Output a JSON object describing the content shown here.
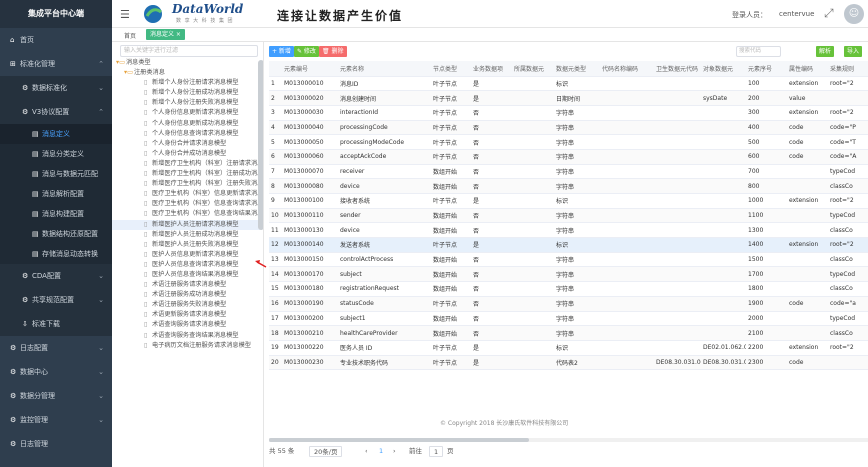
{
  "sidebar": {
    "title": "集成平台中心端",
    "items": [
      {
        "label": "首页",
        "icon": "home-icon"
      },
      {
        "label": "标准化管理",
        "icon": "standard-icon"
      }
    ],
    "sub": [
      {
        "label": "数据标准化"
      },
      {
        "label": "V3协议配置"
      }
    ],
    "sub2": [
      {
        "label": "消息定义"
      },
      {
        "label": "消息分类定义"
      },
      {
        "label": "消息与数据元匹配"
      },
      {
        "label": "消息解析配置"
      },
      {
        "label": "消息构建配置"
      },
      {
        "label": "数据结构还原配置"
      },
      {
        "label": "存储消息动态转换"
      }
    ],
    "sub3": [
      {
        "label": "CDA配置"
      },
      {
        "label": "共享规范配置"
      },
      {
        "label": "标准下载"
      }
    ],
    "bottom": [
      {
        "label": "日志配置"
      },
      {
        "label": "数据中心"
      },
      {
        "label": "数据分管理"
      },
      {
        "label": "监控管理"
      },
      {
        "label": "日志管理"
      }
    ]
  },
  "header": {
    "brand": "DataWorld",
    "brand_sub": "数 享 大 科 技 集 团",
    "slogan": "连接让数据产生价值",
    "login_label": "登录人员：",
    "user": "centervue"
  },
  "tabs": {
    "home": "首页",
    "active": "消息定义 ×"
  },
  "tree": {
    "search_placeholder": "输入关键字进行过滤",
    "root": "消息类型",
    "group": "注册类消息",
    "nodes": [
      "新增个人身份注册请求消息模型",
      "新增个人身份注册成功消息模型",
      "新增个人身份注册失败消息模型",
      "个人身份信息更新请求消息模型",
      "个人身份信息更新成功消息模型",
      "个人身份信息查询请求消息模型",
      "个人身份合并请求消息模型",
      "个人身份合并成功消息模型",
      "新增医疗卫生机构（科室）注册请求消息",
      "新增医疗卫生机构（科室）注册成功消息",
      "新增医疗卫生机构（科室）注册失败消息",
      "医疗卫生机构（科室）信息更新请求消息",
      "医疗卫生机构（科室）信息查询请求消息",
      "医疗卫生机构（科室）信息查询结果消息",
      "新增医护人员注册请求消息模型",
      "新增医护人员注册成功消息模型",
      "新增医护人员注册失败消息模型",
      "医护人员信息更新请求消息模型",
      "医护人员信息查询请求消息模型",
      "医护人员信息查询结果消息模型",
      "术语注册服务请求消息模型",
      "术语注册服务成功消息模型",
      "术语注册服务失败消息模型",
      "术语更新服务请求消息模型",
      "术语查询服务请求消息模型",
      "术语查询服务查询结果消息模型",
      "电子病历文档注册服务请求消息模型"
    ],
    "selected_index": 14
  },
  "toolbar": {
    "add": "+ 新增",
    "edit": "✎ 修改",
    "del": "🗑 删除",
    "search_placeholder": "搜索代码",
    "parse": "解析",
    "batch": "导入"
  },
  "table": {
    "columns": [
      "",
      "元素编号",
      "元素名称",
      "节点类型",
      "业务数据项",
      "所属数据元",
      "数据元类型",
      "代码名称编码",
      "卫生数据元代码",
      "对象数据元",
      "元素序号",
      "属性编码",
      "采集规则"
    ],
    "rows": [
      [
        "1",
        "M013000010",
        "消息ID",
        "叶子节点",
        "是",
        "",
        "标识",
        "",
        "",
        "",
        "100",
        "extension",
        "root=\"2"
      ],
      [
        "2",
        "M013000020",
        "消息创建时间",
        "叶子节点",
        "是",
        "",
        "日期时间",
        "",
        "",
        "sysDate",
        "200",
        "value",
        ""
      ],
      [
        "3",
        "M013000030",
        "interactionId",
        "叶子节点",
        "否",
        "",
        "字符串",
        "",
        "",
        "",
        "300",
        "extension",
        "root=\"2"
      ],
      [
        "4",
        "M013000040",
        "processingCode",
        "叶子节点",
        "否",
        "",
        "字符串",
        "",
        "",
        "",
        "400",
        "code",
        "code=\"P"
      ],
      [
        "5",
        "M013000050",
        "processingModeCode",
        "叶子节点",
        "否",
        "",
        "字符串",
        "",
        "",
        "",
        "500",
        "code",
        "code=\"T"
      ],
      [
        "6",
        "M013000060",
        "acceptAckCode",
        "叶子节点",
        "否",
        "",
        "字符串",
        "",
        "",
        "",
        "600",
        "code",
        "code=\"A"
      ],
      [
        "7",
        "M013000070",
        "receiver",
        "数组开始",
        "否",
        "",
        "字符串",
        "",
        "",
        "",
        "700",
        "",
        "typeCod"
      ],
      [
        "8",
        "M013000080",
        "device",
        "数组开始",
        "否",
        "",
        "字符串",
        "",
        "",
        "",
        "800",
        "",
        "classCo"
      ],
      [
        "9",
        "M013000100",
        "接收者系统",
        "叶子节点",
        "是",
        "",
        "标识",
        "",
        "",
        "",
        "1000",
        "extension",
        "root=\"2"
      ],
      [
        "10",
        "M013000110",
        "sender",
        "数组开始",
        "否",
        "",
        "字符串",
        "",
        "",
        "",
        "1100",
        "",
        "typeCod"
      ],
      [
        "11",
        "M013000130",
        "device",
        "数组开始",
        "否",
        "",
        "字符串",
        "",
        "",
        "",
        "1300",
        "",
        "classCo"
      ],
      [
        "12",
        "M013000140",
        "发送者系统",
        "叶子节点",
        "是",
        "",
        "标识",
        "",
        "",
        "",
        "1400",
        "extension",
        "root=\"2"
      ],
      [
        "13",
        "M013000150",
        "controlActProcess",
        "数组开始",
        "否",
        "",
        "字符串",
        "",
        "",
        "",
        "1500",
        "",
        "classCo"
      ],
      [
        "14",
        "M013000170",
        "subject",
        "数组开始",
        "否",
        "",
        "字符串",
        "",
        "",
        "",
        "1700",
        "",
        "typeCod"
      ],
      [
        "15",
        "M013000180",
        "registrationRequest",
        "数组开始",
        "否",
        "",
        "字符串",
        "",
        "",
        "",
        "1800",
        "",
        "classCo"
      ],
      [
        "16",
        "M013000190",
        "statusCode",
        "叶子节点",
        "否",
        "",
        "字符串",
        "",
        "",
        "",
        "1900",
        "code",
        "code=\"a"
      ],
      [
        "17",
        "M013000200",
        "subject1",
        "数组开始",
        "否",
        "",
        "字符串",
        "",
        "",
        "",
        "2000",
        "",
        "typeCod"
      ],
      [
        "18",
        "M013000210",
        "healthCareProvider",
        "数组开始",
        "否",
        "",
        "字符串",
        "",
        "",
        "",
        "2100",
        "",
        "classCo"
      ],
      [
        "19",
        "M013000220",
        "医务人员 ID",
        "叶子节点",
        "是",
        "",
        "标识",
        "",
        "",
        "DE02.01.062.00",
        "2200",
        "extension",
        "root=\"2"
      ],
      [
        "20",
        "M013000230",
        "专业技术职务代码",
        "叶子节点",
        "是",
        "",
        "代码表2",
        "",
        "DE08.30.031.00",
        "DE08.30.031.00",
        "2300",
        "code",
        ""
      ]
    ],
    "highlight_index": 11
  },
  "pager": {
    "total": "共 55 条",
    "size": "20条/页",
    "prev": "‹",
    "page": "1",
    "next": "›",
    "goto": "前往",
    "page_input": "1",
    "page_suffix": "页"
  },
  "copyright": "© Copyright 2018 长沙康氏软件科技有限公司"
}
